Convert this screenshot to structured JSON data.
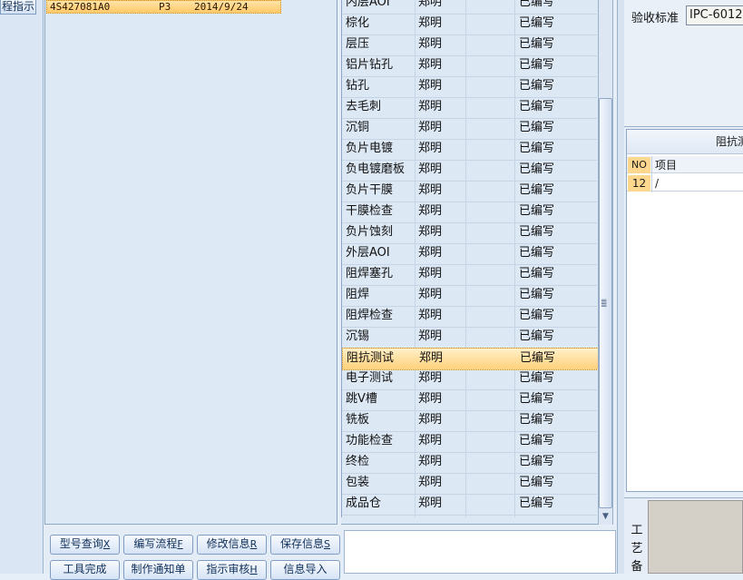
{
  "left_button": {
    "label": "程指示"
  },
  "order": {
    "code": "4S427081A0",
    "level": "P3",
    "date": "2014/9/24"
  },
  "process_rows": [
    {
      "step": "内层AOI",
      "person": "郑明",
      "status": "已编写"
    },
    {
      "step": "棕化",
      "person": "郑明",
      "status": "已编写"
    },
    {
      "step": "层压",
      "person": "郑明",
      "status": "已编写"
    },
    {
      "step": "铝片钻孔",
      "person": "郑明",
      "status": "已编写"
    },
    {
      "step": "钻孔",
      "person": "郑明",
      "status": "已编写"
    },
    {
      "step": "去毛刺",
      "person": "郑明",
      "status": "已编写"
    },
    {
      "step": "沉铜",
      "person": "郑明",
      "status": "已编写"
    },
    {
      "step": "负片电镀",
      "person": "郑明",
      "status": "已编写"
    },
    {
      "step": "负电镀磨板",
      "person": "郑明",
      "status": "已编写"
    },
    {
      "step": "负片干膜",
      "person": "郑明",
      "status": "已编写"
    },
    {
      "step": "干膜检查",
      "person": "郑明",
      "status": "已编写"
    },
    {
      "step": "负片蚀刻",
      "person": "郑明",
      "status": "已编写"
    },
    {
      "step": "外层AOI",
      "person": "郑明",
      "status": "已编写"
    },
    {
      "step": "阻焊塞孔",
      "person": "郑明",
      "status": "已编写"
    },
    {
      "step": "阻焊",
      "person": "郑明",
      "status": "已编写"
    },
    {
      "step": "阻焊检查",
      "person": "郑明",
      "status": "已编写"
    },
    {
      "step": "沉锡",
      "person": "郑明",
      "status": "已编写"
    },
    {
      "step": "阻抗测试",
      "person": "郑明",
      "status": "已编写"
    },
    {
      "step": "电子测试",
      "person": "郑明",
      "status": "已编写"
    },
    {
      "step": "跳V槽",
      "person": "郑明",
      "status": "已编写"
    },
    {
      "step": "铣板",
      "person": "郑明",
      "status": "已编写"
    },
    {
      "step": "功能检查",
      "person": "郑明",
      "status": "已编写"
    },
    {
      "step": "终检",
      "person": "郑明",
      "status": "已编写"
    },
    {
      "step": "包装",
      "person": "郑明",
      "status": "已编写"
    },
    {
      "step": "成品仓",
      "person": "郑明",
      "status": "已编写"
    }
  ],
  "selected_step": "阻抗测试",
  "buttons": {
    "model_query": {
      "label": "型号查询",
      "key": "X"
    },
    "edit_flow": {
      "label": "编写流程",
      "key": "F"
    },
    "modify_info": {
      "label": "修改信息",
      "key": "R"
    },
    "save_info": {
      "label": "保存信息",
      "key": "S"
    },
    "tool_done": {
      "label": "工具完成"
    },
    "make_notice": {
      "label": "制作通知单"
    },
    "review": {
      "label": "指示审核",
      "key": "H"
    },
    "import_info": {
      "label": "信息导入"
    }
  },
  "acceptance": {
    "label": "验收标准",
    "value": "IPC-6012"
  },
  "impedance": {
    "title": "阻抗测",
    "col_no": "NO",
    "col_item": "项目",
    "row_no": "12",
    "row_item": "/"
  },
  "process_note_label": "工艺备"
}
